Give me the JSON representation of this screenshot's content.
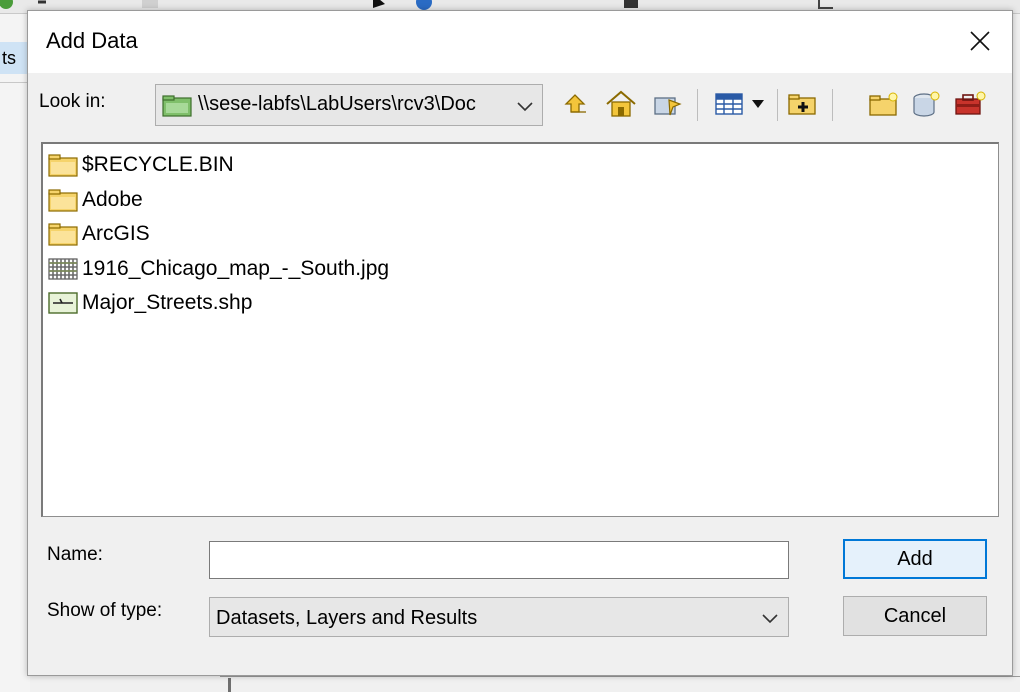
{
  "background": {
    "left_tab_label": "ts"
  },
  "dialog": {
    "title": "Add Data",
    "look_in": {
      "label": "Look in:",
      "path": "\\\\sese-labfs\\LabUsers\\rcv3\\Doc"
    },
    "toolbar": {
      "icons": [
        "up-one-level-icon",
        "home-icon",
        "go-to-location-icon",
        "list-view-icon",
        "view-menu-dropdown-icon",
        "connect-to-folder-icon",
        "new-folder-icon",
        "new-geodatabase-icon",
        "new-toolbox-icon"
      ]
    },
    "files": [
      {
        "name": "$RECYCLE.BIN",
        "icon": "folder"
      },
      {
        "name": "Adobe",
        "icon": "folder"
      },
      {
        "name": "ArcGIS",
        "icon": "folder"
      },
      {
        "name": "1916_Chicago_map_-_South.jpg",
        "icon": "raster"
      },
      {
        "name": "Major_Streets.shp",
        "icon": "line-shapefile"
      }
    ],
    "name_field": {
      "label": "Name:",
      "value": ""
    },
    "type_field": {
      "label": "Show of type:",
      "value": "Datasets, Layers and Results"
    },
    "buttons": {
      "add": "Add",
      "cancel": "Cancel"
    },
    "colors": {
      "accent": "#0078d7",
      "folder": "#f5d36b",
      "window": "#f0f0f0"
    }
  }
}
